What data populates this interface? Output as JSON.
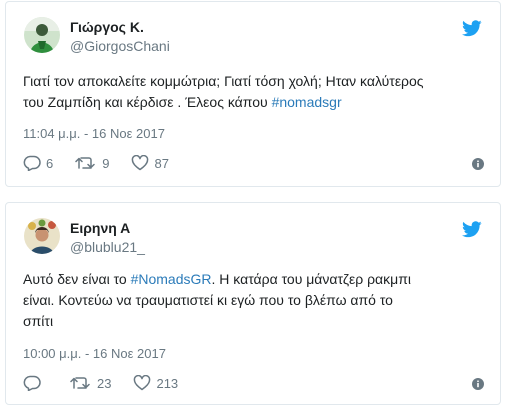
{
  "tweets": [
    {
      "name": "Γιώργος Κ.",
      "handle": "@GiorgosChani",
      "text_lines": [
        "Γιατί τον αποκαλείτε κομμώτρια; Γιατί τόση χολή; Ηταν καλύτερος",
        "του Ζαμπίδη και κέρδισε . Έλεος κάπου "
      ],
      "hashtag": "#nomadsgr",
      "time": "11:04 μ.μ. - 16 Νοε 2017",
      "replies": "6",
      "retweets": "9",
      "likes": "87",
      "accent": "#1da1f2"
    },
    {
      "name": "Ειρηνη Α",
      "handle": "@blublu21_",
      "text_prefix": "Αυτό δεν είναι το ",
      "hashtag": "#NomadsGR",
      "text_suffix": ". Η κατάρα του μάνατζερ ρακμπι",
      "text_lines": [
        "είναι. Κοντεύω να τραυματιστεί κι εγώ που το βλέπω από το",
        "σπίτι"
      ],
      "time": "10:00 μ.μ. - 16 Νοε 2017",
      "replies": "",
      "retweets": "23",
      "likes": "213",
      "accent": "#1da1f2"
    }
  ]
}
